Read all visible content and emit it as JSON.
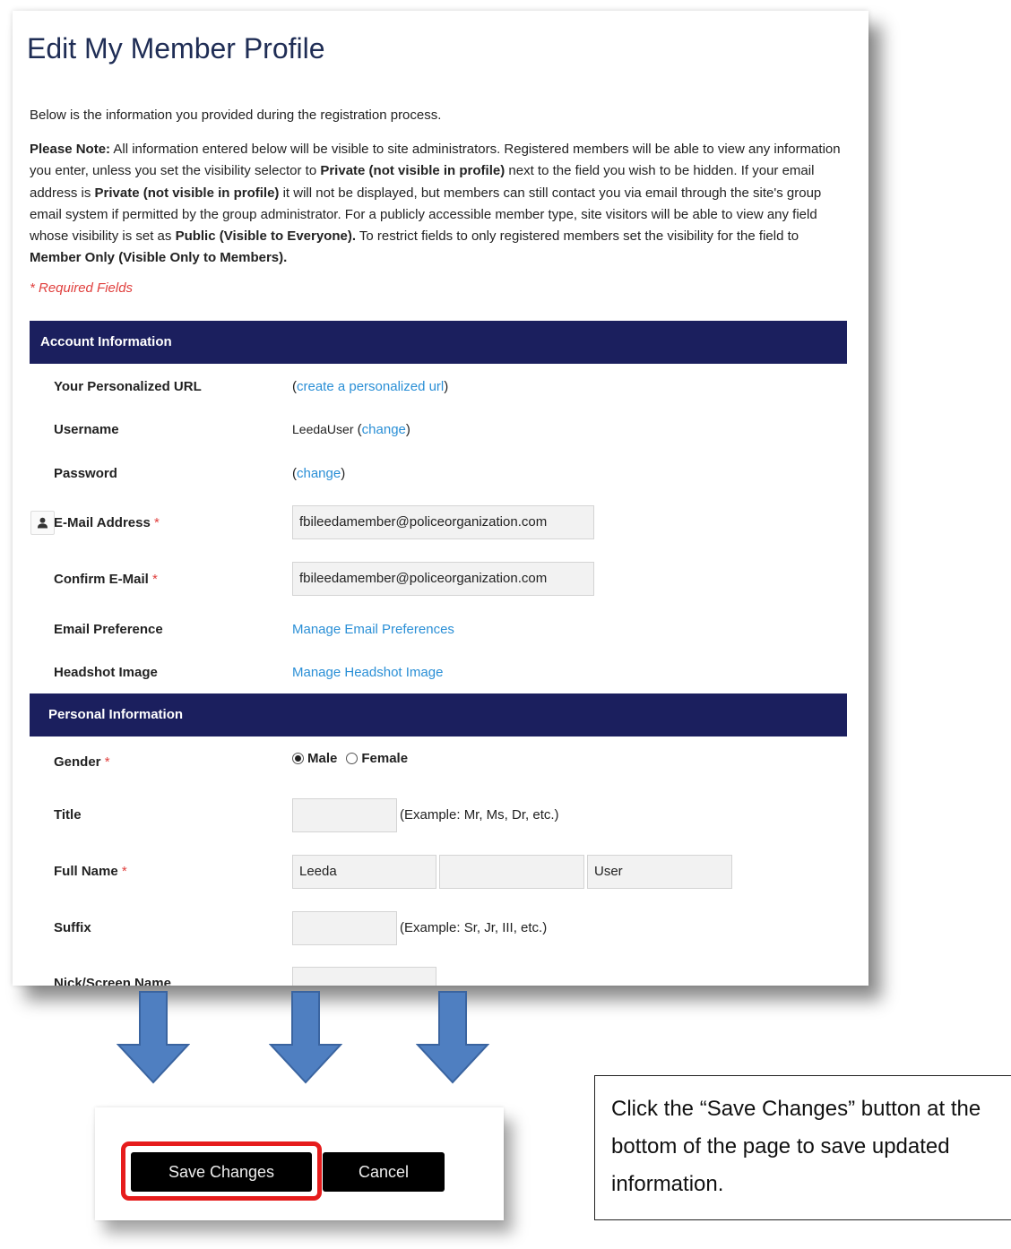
{
  "page": {
    "title": "Edit My Member Profile",
    "intro": "Below is the information you provided during the registration process.",
    "note": {
      "label": "Please Note:",
      "part1": " All information entered below will be visible to site administrators. Registered members will be able to view any information you enter, unless you set the visibility selector to ",
      "private1": "Private (not visible in profile)",
      "part2": " next to the field you wish to be hidden. If your email address is ",
      "private2": "Private (not visible in profile)",
      "part3": " it will not be displayed, but members can still contact you via email through the site's group email system if permitted by the group administrator. For a publicly accessible member type, site visitors will be able to view any field whose visibility is set as ",
      "public": "Public (Visible to Everyone).",
      "part4": " To restrict fields to only registered members set the visibility for the field to ",
      "member_only": "Member Only (Visible Only to Members).",
      "end": ""
    },
    "required_note": "* Required Fields"
  },
  "account": {
    "header": "Account Information",
    "personalized_url_label": "Your Personalized URL",
    "personalized_url_open": "(",
    "personalized_url_link": "create a personalized url",
    "personalized_url_close": ")",
    "username_label": "Username",
    "username_value": "LeedaUser",
    "username_change_open": " (",
    "username_change_link": "change",
    "username_change_close": ")",
    "password_label": "Password",
    "password_open": "(",
    "password_change_link": "change",
    "password_close": ")",
    "email_label": "E-Mail Address",
    "email_value": "fbileedamember@policeorganization.com",
    "confirm_email_label": "Confirm E-Mail",
    "confirm_email_value": "fbileedamember@policeorganization.com",
    "email_pref_label": "Email Preference",
    "email_pref_link": "Manage Email Preferences",
    "headshot_label": "Headshot Image",
    "headshot_link": "Manage Headshot Image",
    "required_mark": "*"
  },
  "personal": {
    "header": "Personal Information",
    "gender_label": "Gender",
    "gender_options": [
      "Male",
      "Female"
    ],
    "gender_selected": "Male",
    "title_label": "Title",
    "title_value": "",
    "title_example": "(Example: Mr, Ms, Dr, etc.)",
    "full_name_label": "Full Name",
    "first_name": "Leeda",
    "middle_name": "",
    "last_name": "User",
    "suffix_label": "Suffix",
    "suffix_value": "",
    "suffix_example": "(Example: Sr, Jr, III, etc.)",
    "nick_label": "Nick/Screen Name",
    "required_mark": "*"
  },
  "buttons": {
    "save_label": "Save Changes",
    "cancel_label": "Cancel"
  },
  "callout": {
    "text": "Click the “Save Changes” button at the bottom of the page to save updated information."
  },
  "colors": {
    "section_header_bg": "#1b1f5e",
    "link": "#2a8fd6",
    "required": "#e0403e",
    "arrow": "#4f7fc1",
    "highlight": "#e61c1c"
  },
  "icons": {
    "email_visibility": "user-icon",
    "arrow": "down-arrow-icon"
  }
}
